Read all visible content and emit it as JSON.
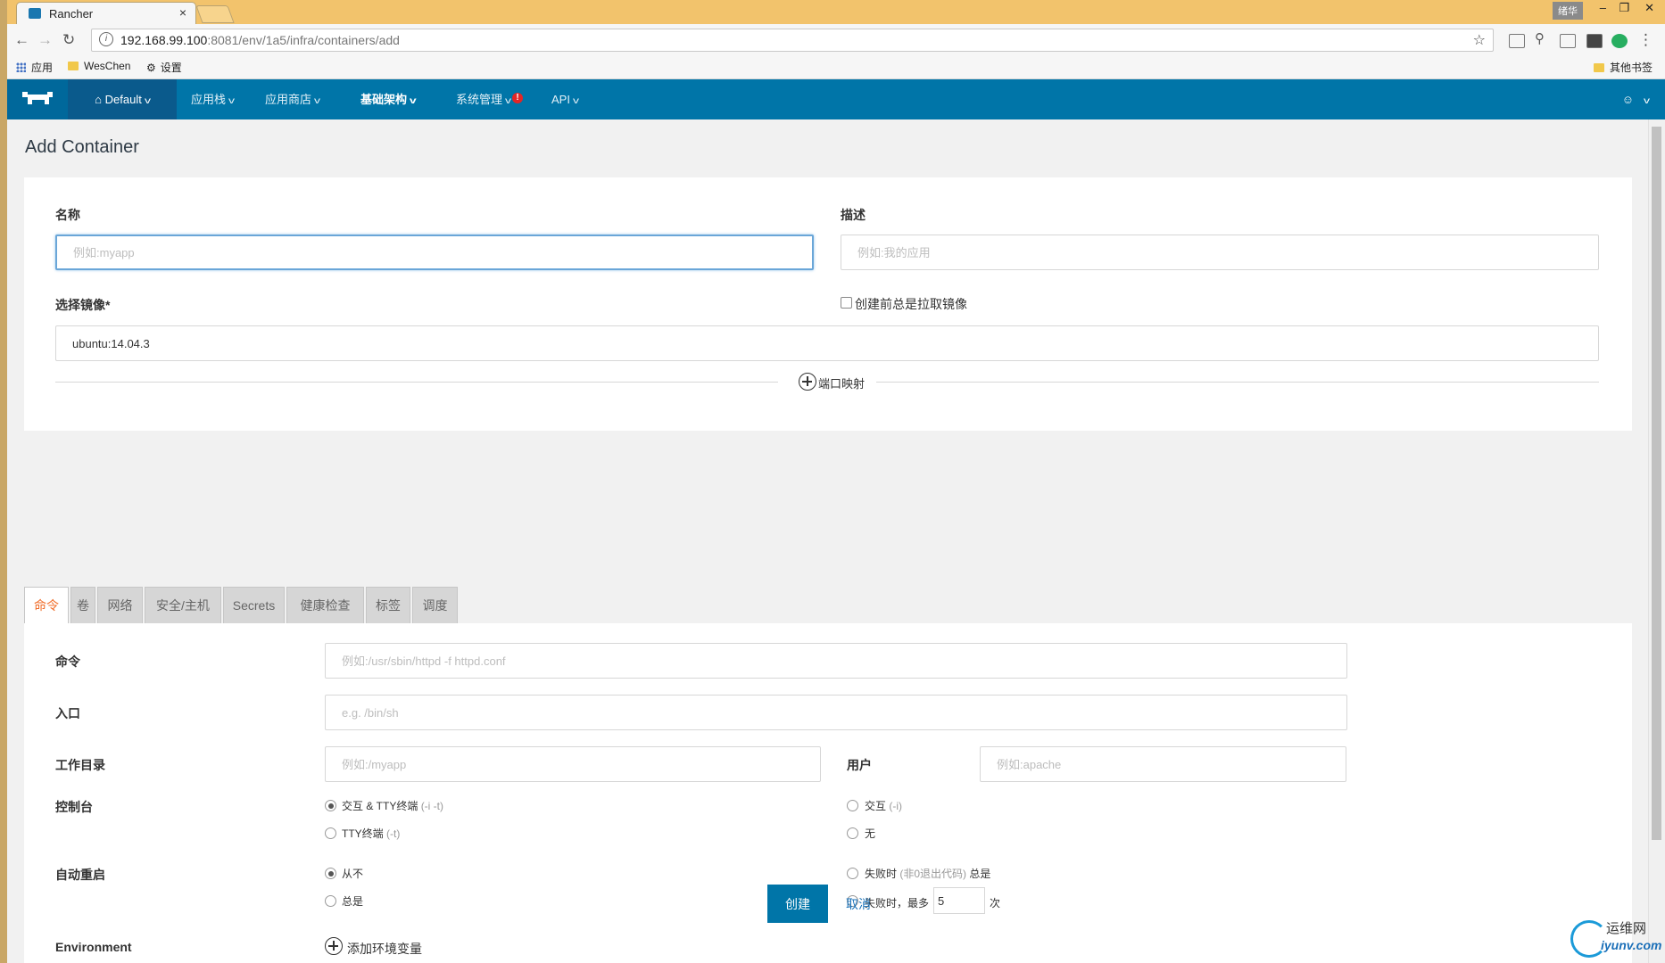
{
  "browser": {
    "tab_title": "Rancher",
    "tab_close": "×",
    "window_user": "绪华",
    "win_min": "–",
    "win_max": "❐",
    "win_close": "✕",
    "url_host": "192.168.99.100",
    "url_rest": ":8081/env/1a5/infra/containers/add",
    "bookmarks": {
      "apps": "应用",
      "weschen": "WesChen",
      "settings": "设置",
      "other": "其他书签"
    }
  },
  "nav": {
    "env": "Default",
    "items": {
      "stacks": "应用栈",
      "catalog": "应用商店",
      "infra": "基础架构",
      "admin": "系统管理",
      "api": "API"
    },
    "admin_badge": "!"
  },
  "page": {
    "title": "Add Container"
  },
  "form": {
    "name_label": "名称",
    "name_placeholder": "例如:myapp",
    "desc_label": "描述",
    "desc_placeholder": "例如:我的应用",
    "image_label": "选择镜像*",
    "pull_label": "创建前总是拉取镜像",
    "image_value": "ubuntu:14.04.3",
    "port_map_label": "端口映射"
  },
  "tabs": [
    "命令",
    "卷",
    "网络",
    "安全/主机",
    "Secrets",
    "健康检查",
    "标签",
    "调度"
  ],
  "command": {
    "cmd_label": "命令",
    "cmd_placeholder": "例如:/usr/sbin/httpd -f httpd.conf",
    "entry_label": "入口",
    "entry_placeholder": "e.g. /bin/sh",
    "workdir_label": "工作目录",
    "workdir_placeholder": "例如:/myapp",
    "user_label": "用户",
    "user_placeholder": "例如:apache",
    "console_label": "控制台",
    "console_opt1": "交互 & TTY终端",
    "console_opt1_hint": "(-i -t)",
    "console_opt2": "交互",
    "console_opt2_hint": "(-i)",
    "console_opt3": "TTY终端",
    "console_opt3_hint": "(-t)",
    "console_opt4": "无",
    "restart_label": "自动重启",
    "restart_never": "从不",
    "restart_fail_a": "失败时",
    "restart_fail_hint": "(非0退出代码)",
    "restart_fail_b": "总是",
    "restart_always": "总是",
    "restart_maxn_a": "失败时，最多",
    "restart_max_value": "5",
    "restart_maxn_b": "次",
    "env_label": "Environment",
    "env_add": "添加环境变量"
  },
  "actions": {
    "create": "创建",
    "cancel": "取消"
  },
  "watermark": {
    "line1": "运维网",
    "line2": "iyunv.com"
  }
}
